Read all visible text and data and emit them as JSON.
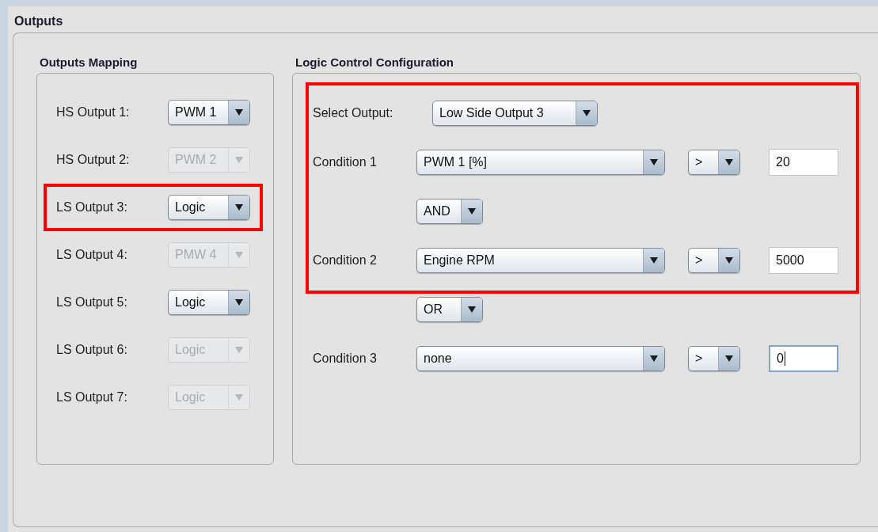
{
  "title": "Outputs",
  "mapping": {
    "title": "Outputs Mapping",
    "rows": [
      {
        "label": "HS Output 1:",
        "value": "PWM 1",
        "disabled": false,
        "highlighted": false
      },
      {
        "label": "HS Output 2:",
        "value": "PWM 2",
        "disabled": true,
        "highlighted": false
      },
      {
        "label": "LS Output 3:",
        "value": "Logic",
        "disabled": false,
        "highlighted": true
      },
      {
        "label": "LS Output 4:",
        "value": "PMW 4",
        "disabled": true,
        "highlighted": false
      },
      {
        "label": "LS Output 5:",
        "value": "Logic",
        "disabled": false,
        "highlighted": false
      },
      {
        "label": "LS Output 6:",
        "value": "Logic",
        "disabled": true,
        "highlighted": false
      },
      {
        "label": "LS Output 7:",
        "value": "Logic",
        "disabled": true,
        "highlighted": false
      }
    ]
  },
  "logic": {
    "title": "Logic Control Configuration",
    "rows": [
      {
        "kind": "select",
        "label": "Select Output:",
        "value": "Low Side Output 3",
        "highlighted": true
      },
      {
        "kind": "condition",
        "label": "Condition 1",
        "source": "PWM 1 [%]",
        "operator": ">",
        "threshold": "20",
        "focused": false,
        "highlighted": true
      },
      {
        "kind": "joiner",
        "value": "AND",
        "highlighted": true
      },
      {
        "kind": "condition",
        "label": "Condition 2",
        "source": "Engine RPM",
        "operator": ">",
        "threshold": "5000",
        "focused": false,
        "highlighted": true
      },
      {
        "kind": "joiner",
        "value": "OR",
        "highlighted": false
      },
      {
        "kind": "condition",
        "label": "Condition 3",
        "source": "none",
        "operator": ">",
        "threshold": "0",
        "focused": true,
        "highlighted": false
      }
    ]
  }
}
